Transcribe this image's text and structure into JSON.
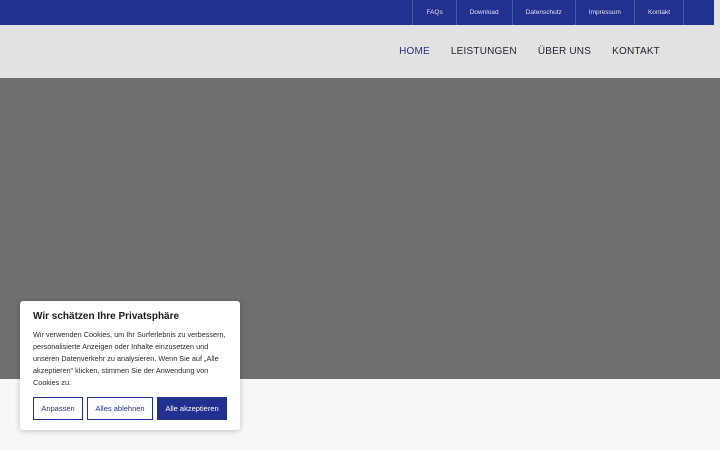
{
  "topbar": {
    "links": [
      "FAQs",
      "Download",
      "Datenschutz",
      "Impressum",
      "Kontakt"
    ]
  },
  "nav": {
    "items": [
      "HOME",
      "LEISTUNGEN",
      "ÜBER UNS",
      "KONTAKT"
    ],
    "active": "HOME"
  },
  "cookie": {
    "title": "Wir schätzen Ihre Privatsphäre",
    "text": "Wir verwenden Cookies, um Ihr Surferlebnis zu verbessern, personalisierte Anzeigen oder Inhalte einzusetzen und unseren Datenverkehr zu analysieren. Wenn Sie auf „Alle akzeptieren“ klicken, stimmen Sie der Anwendung von Cookies zu.",
    "customize_label": "Anpassen",
    "reject_label": "Alles ablehnen",
    "accept_label": "Alle akzeptieren"
  },
  "colors": {
    "brand": "#22308f",
    "header_bg": "#e2e2e2",
    "hero_overlay": "#6f6f6f"
  }
}
